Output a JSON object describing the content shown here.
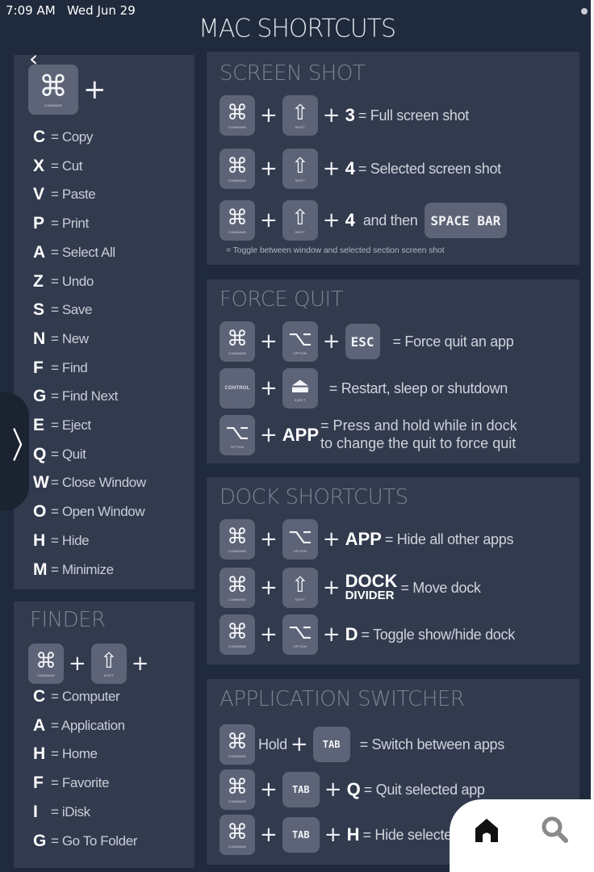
{
  "status_bar": {
    "time": "7:09 AM",
    "date": "Wed Jun 29"
  },
  "title": "MAC SHORTCUTS",
  "nav": {
    "back_icon": "chevron-left-icon",
    "sidebar_toggle_icon": "chevron-right-icon"
  },
  "keys": {
    "command": {
      "glyph": "⌘",
      "label": "COMMAND"
    },
    "shift": {
      "glyph": "⇧",
      "label": "SHIFT"
    },
    "option": {
      "glyph": "⌥",
      "label": "OPTION"
    },
    "control": {
      "label": "CONTROL"
    },
    "eject": {
      "glyph": "⏏",
      "label": "EJECT"
    },
    "esc": "ESC",
    "tab": "TAB",
    "space_bar": "SPACE BAR"
  },
  "plus": "+",
  "command_list": {
    "items": [
      {
        "key": "C",
        "desc": "= Copy"
      },
      {
        "key": "X",
        "desc": "= Cut"
      },
      {
        "key": "V",
        "desc": "= Paste"
      },
      {
        "key": "P",
        "desc": "= Print"
      },
      {
        "key": "A",
        "desc": "= Select All"
      },
      {
        "key": "Z",
        "desc": "= Undo"
      },
      {
        "key": "S",
        "desc": "= Save"
      },
      {
        "key": "N",
        "desc": "= New"
      },
      {
        "key": "F",
        "desc": "= Find"
      },
      {
        "key": "G",
        "desc": "= Find Next"
      },
      {
        "key": "E",
        "desc": "= Eject"
      },
      {
        "key": "Q",
        "desc": "= Quit"
      },
      {
        "key": "W",
        "desc": "= Close Window"
      },
      {
        "key": "O",
        "desc": "= Open Window"
      },
      {
        "key": "H",
        "desc": "= Hide"
      },
      {
        "key": "M",
        "desc": "= Minimize"
      }
    ]
  },
  "finder": {
    "title": "FINDER",
    "items": [
      {
        "key": "C",
        "desc": "= Computer"
      },
      {
        "key": "A",
        "desc": "= Application"
      },
      {
        "key": "H",
        "desc": "= Home"
      },
      {
        "key": "F",
        "desc": "= Favorite"
      },
      {
        "key": "I",
        "desc": "= iDisk"
      },
      {
        "key": "G",
        "desc": "= Go To Folder"
      }
    ]
  },
  "screen_shot": {
    "title": "SCREEN SHOT",
    "rows": [
      {
        "key": "3",
        "desc": "= Full screen shot"
      },
      {
        "key": "4",
        "desc": "= Selected screen shot"
      },
      {
        "key": "4",
        "mid": "and then"
      }
    ],
    "note": "= Toggle between window and selected section screen shot"
  },
  "force_quit": {
    "title": "FORCE QUIT",
    "rows": [
      {
        "desc": "= Force quit an app"
      },
      {
        "desc": "= Restart, sleep or shutdown"
      },
      {
        "key": "APP",
        "desc_line1": "= Press and hold while in dock",
        "desc_line2": "to change the quit to force quit"
      }
    ]
  },
  "dock": {
    "title": "DOCK SHORTCUTS",
    "rows": [
      {
        "key": "APP",
        "desc": "= Hide all other apps"
      },
      {
        "key_line1": "DOCK",
        "key_line2": "DIVIDER",
        "desc": "= Move dock"
      },
      {
        "key": "D",
        "desc": "= Toggle show/hide dock"
      }
    ]
  },
  "app_switcher": {
    "title": "APPLICATION SWITCHER",
    "rows": [
      {
        "hold": "Hold",
        "desc": "= Switch between apps"
      },
      {
        "key": "Q",
        "desc": "= Quit selected app"
      },
      {
        "key": "H",
        "desc": "= Hide selected app"
      }
    ]
  },
  "bottom_nav": {
    "home_icon": "home-icon",
    "search_icon": "search-icon"
  }
}
